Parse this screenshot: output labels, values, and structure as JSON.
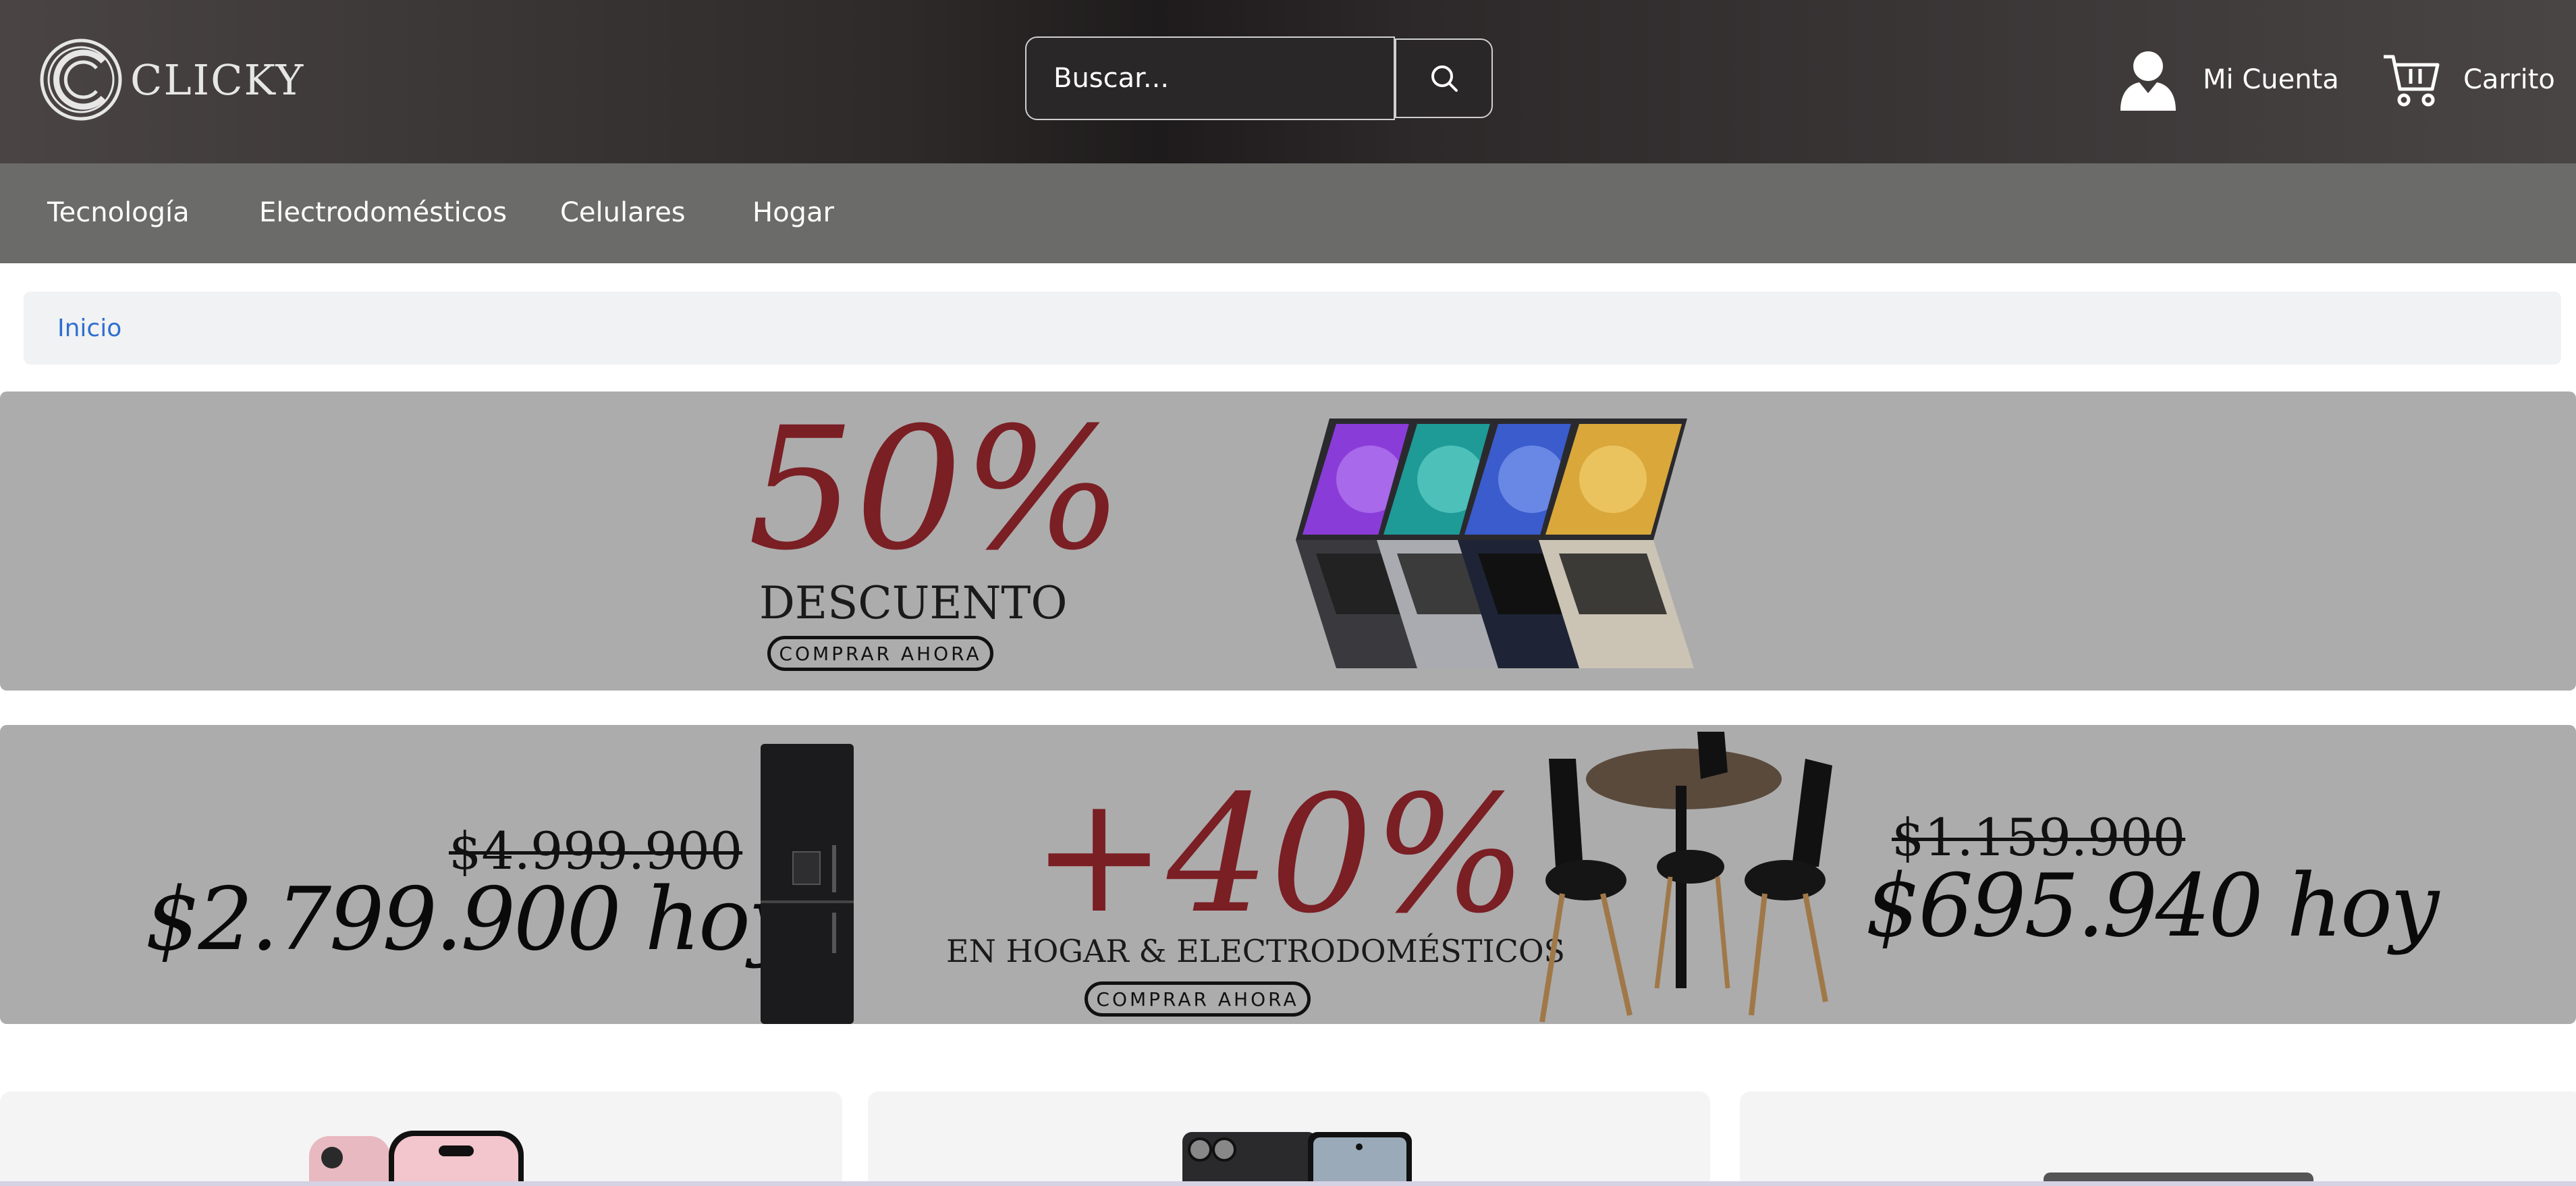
{
  "header": {
    "logo_text": "CLICKY",
    "search_placeholder": "Buscar...",
    "account_label": "Mi Cuenta",
    "cart_label": "Carrito"
  },
  "nav": {
    "items": [
      {
        "label": "Tecnología"
      },
      {
        "label": "Electrodomésticos"
      },
      {
        "label": "Celulares"
      },
      {
        "label": "Hogar"
      }
    ]
  },
  "breadcrumb": {
    "items": [
      {
        "label": "Inicio"
      }
    ]
  },
  "banner_laptops": {
    "percent": "50%",
    "subtitle": "DESCUENTO",
    "cta": "COMPRAR AHORA",
    "laptop_colors": [
      "#8a3cd8",
      "#1e9a97",
      "#3b5ccc",
      "#d9a73a"
    ]
  },
  "banner_home": {
    "left_old_price": "$4.999.900",
    "left_new_price": "$2.799.900 hoy",
    "percent": "+40%",
    "subtitle": "EN HOGAR & ELECTRODOMÉSTICOS",
    "cta": "COMPRAR AHORA",
    "right_old_price": "$1.159.900",
    "right_new_price": "$695.940 hoy"
  },
  "colors": {
    "header_bg": "#2e2a2a",
    "nav_bg": "#6b6b69",
    "banner_bg": "#acacac",
    "promo_red": "#7a1f24",
    "link_blue": "#2f6fce"
  },
  "icons": [
    "logo-c-icon",
    "search-icon",
    "user-icon",
    "cart-icon"
  ]
}
